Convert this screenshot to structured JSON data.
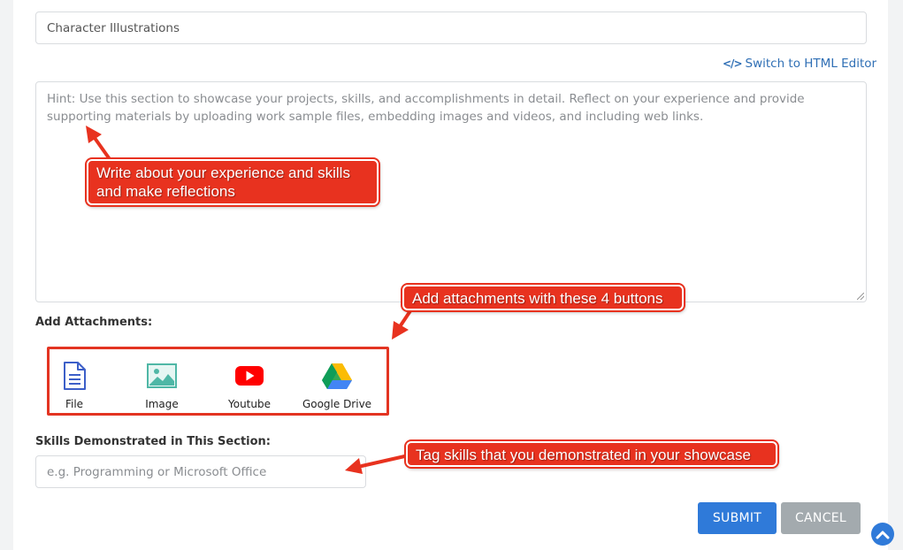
{
  "form": {
    "title_value": "Character Illustrations",
    "html_editor_link": "Switch to HTML Editor",
    "description_placeholder": "Hint: Use this section to showcase your projects, skills, and accomplishments in detail. Reflect on your experience and provide supporting materials by uploading work sample files, embedding images and videos, and including web links.",
    "attachments_label": "Add Attachments:",
    "attachment_buttons": [
      {
        "label": "File",
        "icon": "file-icon"
      },
      {
        "label": "Image",
        "icon": "image-icon"
      },
      {
        "label": "Youtube",
        "icon": "youtube-icon"
      },
      {
        "label": "Google Drive",
        "icon": "google-drive-icon"
      }
    ],
    "skills_label": "Skills Demonstrated in This Section:",
    "skills_placeholder": "e.g. Programming or Microsoft Office",
    "submit_label": "SUBMIT",
    "cancel_label": "CANCEL"
  },
  "annotations": {
    "reflection_note": "Write about your experience and skills and make reflections",
    "attachments_note": "Add attachments with these 4 buttons",
    "skills_note": "Tag skills that you demonstrated in your showcase"
  },
  "colors": {
    "accent_blue": "#2f7ad9",
    "link_blue": "#2f6fb5",
    "cancel_gray": "#a3aaae",
    "annotation_red": "#e8321f"
  }
}
